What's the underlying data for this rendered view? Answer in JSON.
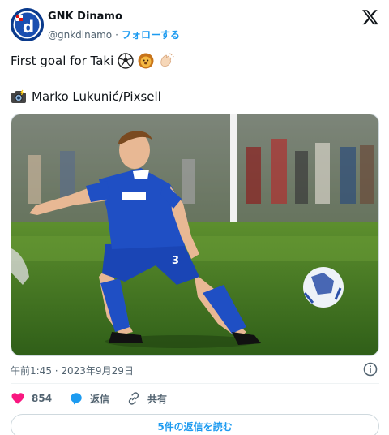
{
  "account": {
    "display_name": "GNK Dinamo",
    "handle": "@gnkdinamo",
    "separator": "·",
    "follow_label": "フォローする",
    "avatar_icon": "dinamo-crest-icon",
    "platform_icon": "x-logo-icon"
  },
  "tweet": {
    "text": "First goal for Taki",
    "emojis": [
      "soccer-ball-icon",
      "lion-icon",
      "clapping-hands-icon"
    ],
    "credit_icon": "camera-flash-icon",
    "credit": "Marko Lukunić/Pixsell",
    "timestamp": "午前1:45 · 2023年9月29日"
  },
  "media": {
    "description_icon": "photo",
    "shirt_number": "3"
  },
  "actions": {
    "like_count": "854",
    "reply_label": "返信",
    "share_label": "共有"
  },
  "read_replies_label": "5件の返信を読む",
  "colors": {
    "accent": "#1d9bf0",
    "like": "#f91880",
    "text": "#0f1419",
    "muted": "#536471",
    "kit_blue": "#1f4fc4"
  }
}
